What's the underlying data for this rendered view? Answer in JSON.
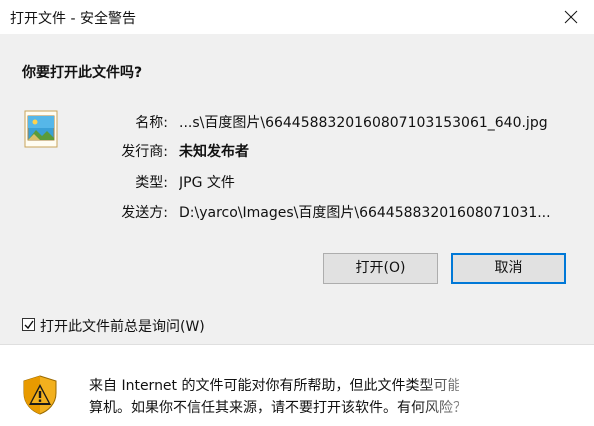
{
  "window": {
    "title": "打开文件 - 安全警告",
    "close_glyph": "close-icon"
  },
  "dialog": {
    "question": "你要打开此文件吗?",
    "icon": "image-file-icon",
    "fields": [
      {
        "label": "名称:",
        "value": "...s\\百度图片\\6644588320160807103153061_640.jpg",
        "bold": false
      },
      {
        "label": "发行商:",
        "value": "未知发布者",
        "bold": true
      },
      {
        "label": "类型:",
        "value": "JPG 文件",
        "bold": false
      },
      {
        "label": "发送方:",
        "value": "D:\\yarco\\Images\\百度图片\\66445883201608071031...",
        "bold": false
      }
    ],
    "buttons": {
      "open": "打开(O)",
      "cancel": "取消"
    },
    "checkbox": {
      "label": "打开此文件前总是询问(W)",
      "checked": true
    }
  },
  "footer": {
    "icon": "security-shield-warning-icon",
    "line1": "来自 Internet 的文件可能对你有所帮助，但此文件类型可能危害你的计",
    "line2": "算机。如果你不信任其来源，请不要打开该软件。有何风险？"
  },
  "colors": {
    "body_bg": "#f0f0f0",
    "accent": "#0078d7",
    "button_bg": "#e1e1e1"
  }
}
